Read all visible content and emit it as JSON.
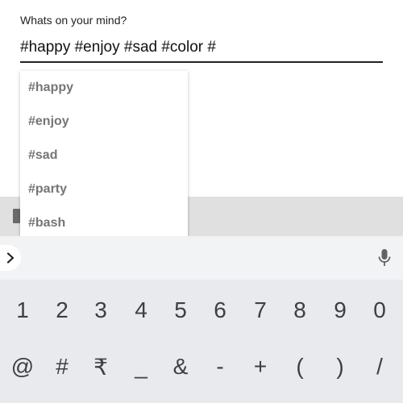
{
  "composer": {
    "label": "Whats on your mind?",
    "value": "#happy #enjoy #sad #color #"
  },
  "suggestions": [
    "#happy",
    "#enjoy",
    "#sad",
    "#party",
    "#bash"
  ],
  "keyboard": {
    "expand_icon": "chevron-right-icon",
    "mic_icon": "microphone-icon",
    "digits": [
      "1",
      "2",
      "3",
      "4",
      "5",
      "6",
      "7",
      "8",
      "9",
      "0"
    ],
    "symbols": [
      "@",
      "#",
      "₹",
      "_",
      "&",
      "-",
      "+",
      "(",
      ")",
      "/"
    ]
  },
  "colors": {
    "text": "#222222",
    "suggestion_text": "#757575",
    "keyboard_bg": "#e8eaed",
    "key_text": "#3c4043"
  }
}
